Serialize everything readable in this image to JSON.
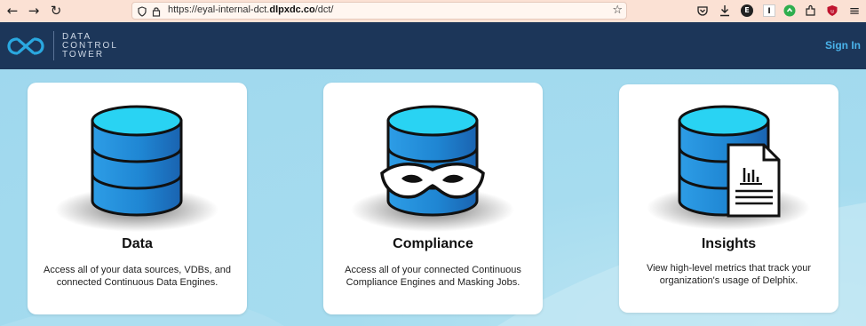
{
  "browser": {
    "url_prefix": "https://eyal-internal-dct.",
    "url_domain": "dlpxdc.co",
    "url_suffix": "/dct/",
    "back_glyph": "←",
    "forward_glyph": "→",
    "reload_glyph": "↻",
    "star_glyph": "☆",
    "menu_glyph": "≡",
    "ext_letter_e": "E",
    "ext_letter_i": "I"
  },
  "header": {
    "logo_line1": "DATA",
    "logo_line2": "CONTROL",
    "logo_line3": "TOWER",
    "signin_label": "Sign In"
  },
  "cards": [
    {
      "title": "Data",
      "desc_line1": "Access all of your data sources, VDBs, and",
      "desc_line2": "connected Continuous Data Engines."
    },
    {
      "title": "Compliance",
      "desc_line1": "Access all of your connected Continuous",
      "desc_line2": "Compliance Engines and Masking Jobs."
    },
    {
      "title": "Insights",
      "desc_line1": "View high-level metrics that track your",
      "desc_line2": "organization's usage of Delphix."
    }
  ],
  "colors": {
    "header_bg": "#1c3659",
    "accent": "#4ab3ea",
    "db_top": "#29d0f0",
    "db_body": "#1f8fd6"
  }
}
